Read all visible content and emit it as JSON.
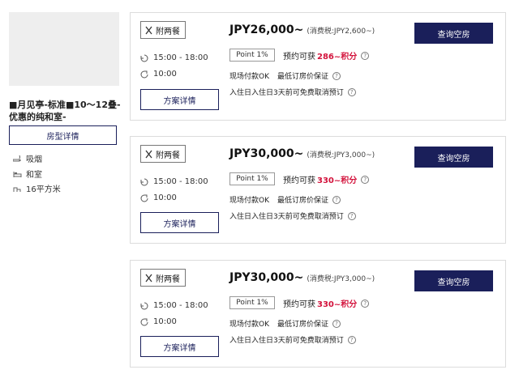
{
  "room": {
    "title": "■月见亭-标准■10～12叠-优惠的纯和室-",
    "detail_button": "房型详情",
    "features": [
      {
        "icon": "smoking-icon",
        "label": "吸烟"
      },
      {
        "icon": "bed-icon",
        "label": "和室"
      },
      {
        "icon": "area-icon",
        "label": "16平方米"
      }
    ]
  },
  "plans": [
    {
      "meal": "附两餐",
      "checkin": "15:00 - 18:00",
      "checkout": "10:00",
      "plan_button": "方案详情",
      "price": "JPY26,000~",
      "tax": "(消费税:JPY2,600~)",
      "point_badge": "Point 1%",
      "earn_label": "预约可获",
      "earn_points": "286~积分",
      "pay_tag": "现场付款OK",
      "guarantee_tag": "最低订房价保证",
      "cancel_text": "入住日入住日3天前可免费取消预订",
      "search_button": "查询空房"
    },
    {
      "meal": "附两餐",
      "checkin": "15:00 - 18:00",
      "checkout": "10:00",
      "plan_button": "方案详情",
      "price": "JPY30,000~",
      "tax": "(消费税:JPY3,000~)",
      "point_badge": "Point 1%",
      "earn_label": "预约可获",
      "earn_points": "330~积分",
      "pay_tag": "现场付款OK",
      "guarantee_tag": "最低订房价保证",
      "cancel_text": "入住日入住日3天前可免费取消预订",
      "search_button": "查询空房"
    },
    {
      "meal": "附两餐",
      "checkin": "15:00 - 18:00",
      "checkout": "10:00",
      "plan_button": "方案详情",
      "price": "JPY30,000~",
      "tax": "(消费税:JPY3,000~)",
      "point_badge": "Point 1%",
      "earn_label": "预约可获",
      "earn_points": "330~积分",
      "pay_tag": "现场付款OK",
      "guarantee_tag": "最低订房价保证",
      "cancel_text": "入住日入住日3天前可免费取消预订",
      "search_button": "查询空房"
    }
  ],
  "colors": {
    "accent": "#1a1f5a",
    "points": "#d3133c",
    "border": "#dcdcdc"
  }
}
